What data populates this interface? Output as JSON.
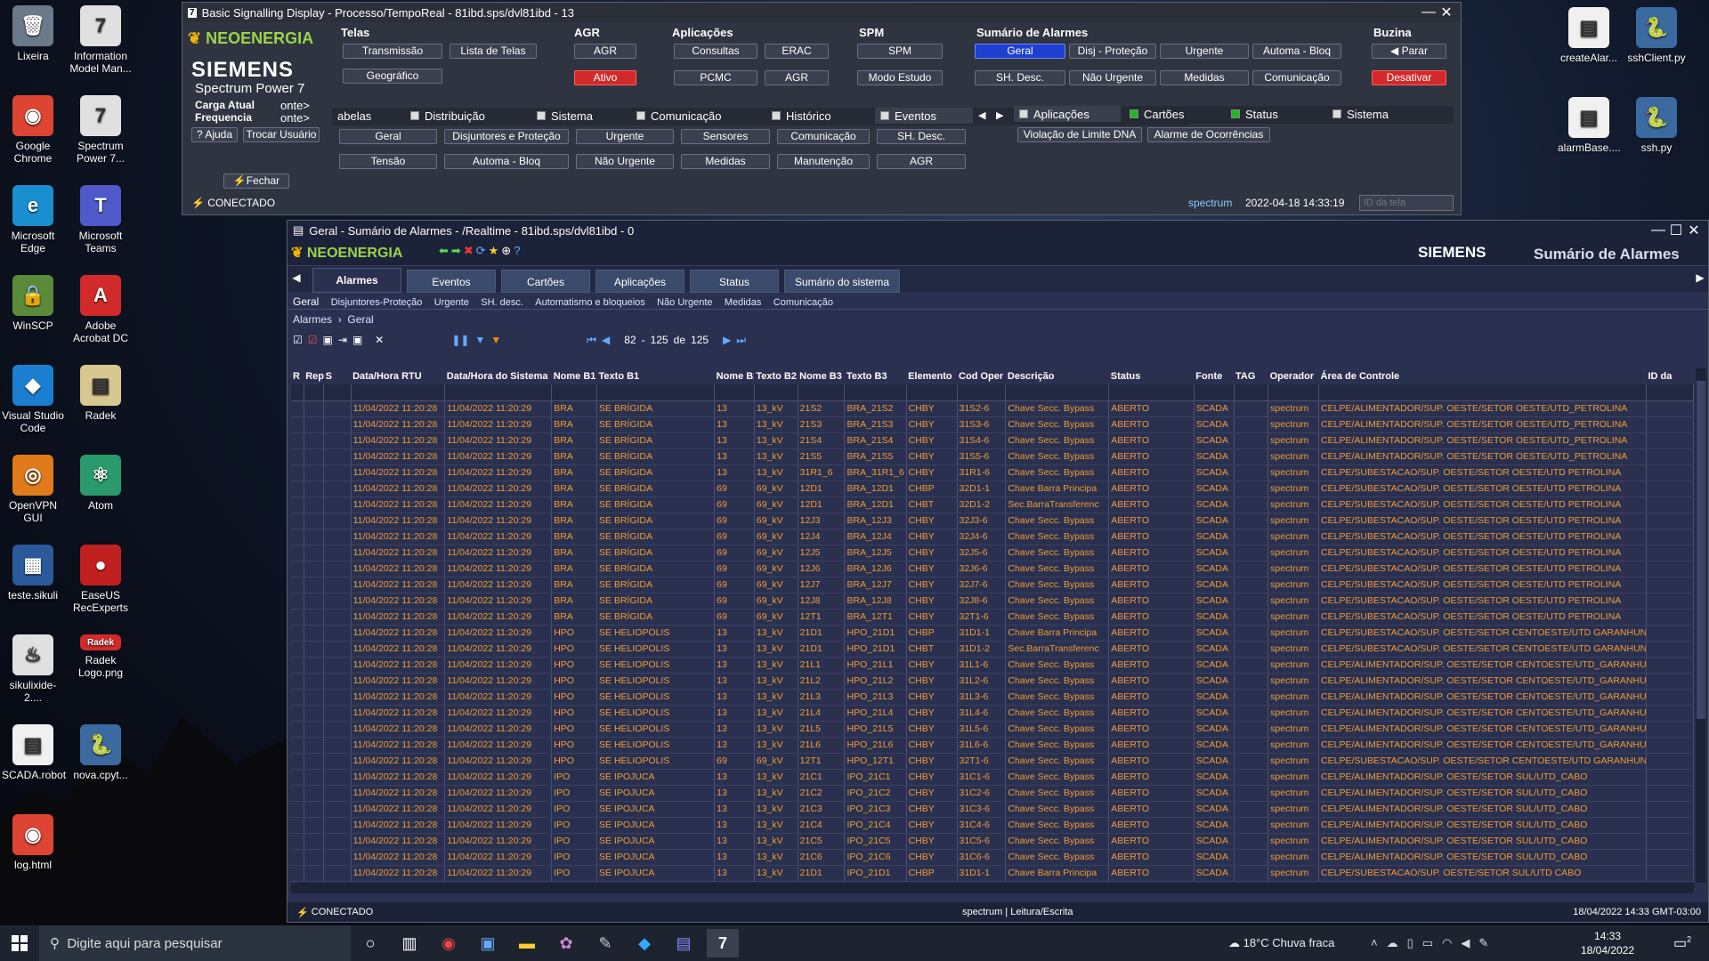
{
  "desktop": {
    "icons": [
      {
        "label": "Lixeira",
        "glyph": "🗑",
        "bg": "#6b7a8a"
      },
      {
        "label": "Information Model Man...",
        "glyph": "7",
        "bg": "#e0e0e0"
      },
      {
        "label": "Google Chrome",
        "glyph": "◉",
        "bg": "#dd4433"
      },
      {
        "label": "Spectrum Power 7...",
        "glyph": "7",
        "bg": "#e0e0e0"
      },
      {
        "label": "Microsoft Edge",
        "glyph": "e",
        "bg": "#1a8fd0"
      },
      {
        "label": "Microsoft Teams",
        "glyph": "T",
        "bg": "#5059c9"
      },
      {
        "label": "WinSCP",
        "glyph": "🔒",
        "bg": "#5a8a3a"
      },
      {
        "label": "Adobe Acrobat DC",
        "glyph": "A",
        "bg": "#d22a2a"
      },
      {
        "label": "Visual Studio Code",
        "glyph": "◆",
        "bg": "#1a7fd0"
      },
      {
        "label": "Radek",
        "glyph": "▤",
        "bg": "#d8c890"
      },
      {
        "label": "OpenVPN GUI",
        "glyph": "◎",
        "bg": "#e07a1a"
      },
      {
        "label": "Atom",
        "glyph": "⚛",
        "bg": "#2a9a6a"
      },
      {
        "label": "teste.sikuli",
        "glyph": "▦",
        "bg": "#2a5a9a"
      },
      {
        "label": "EaseUS RecExperts",
        "glyph": "●",
        "bg": "#c02020"
      },
      {
        "label": "sikulixide-2....",
        "glyph": "♨",
        "bg": "#e0e0e0"
      },
      {
        "label": "Radek Logo.png",
        "glyph": "Radek",
        "bg": "#d22a2a"
      },
      {
        "label": "SCADA.robot",
        "glyph": "▤",
        "bg": "#f0f0f0"
      },
      {
        "label": "nova.cpyt...",
        "glyph": "🐍",
        "bg": "#3a6aa0"
      },
      {
        "label": "log.html",
        "glyph": "◉",
        "bg": "#dd4433"
      }
    ],
    "right_icons": [
      {
        "label": "createAlar...",
        "glyph": "▤",
        "bg": "#f0f0f0"
      },
      {
        "label": "sshClient.py",
        "glyph": "🐍",
        "bg": "#3a6aa0"
      },
      {
        "label": "alarmBase....",
        "glyph": "▤",
        "bg": "#f0f0f0"
      },
      {
        "label": "ssh.py",
        "glyph": "🐍",
        "bg": "#3a6aa0"
      }
    ]
  },
  "w1": {
    "title": "Basic Signalling Display - Processo/TempoReal - 81ibd.sps/dvl81ibd - 13",
    "logo": "NEOENERGIA",
    "siemens": "SIEMENS",
    "product": "Spectrum Power 7",
    "carga": "Carga Atual",
    "freq": "Frequencia",
    "conte1": "onte>",
    "conte2": "onte>",
    "ajuda": "Ajuda",
    "trocar": "Trocar Usuário",
    "fechar": "Fechar",
    "conectado": "CONECTADO",
    "sections": {
      "telas": "Telas",
      "agr": "AGR",
      "aplicacoes": "Aplicações",
      "spm": "SPM",
      "sumario": "Sumário de Alarmes",
      "buzina": "Buzina"
    },
    "btn": {
      "transmissao": "Transmissão",
      "lista": "Lista de Telas",
      "geografico": "Geográfico",
      "agr": "AGR",
      "ativo": "Ativo",
      "consultas": "Consultas",
      "erac": "ERAC",
      "pcmc": "PCMC",
      "agr2": "AGR",
      "spm": "SPM",
      "modo": "Modo Estudo",
      "geral": "Geral",
      "disj": "Disj - Proteção",
      "urgente": "Urgente",
      "automa": "Automa - Bloq",
      "shdesc": "SH. Desc.",
      "naourg": "Não Urgente",
      "medidas": "Medidas",
      "comunic": "Comunicação",
      "parar": "Parar",
      "desativar": "Desativar"
    },
    "tabs": [
      "abelas",
      "Distribuição",
      "Sistema",
      "Comunicação",
      "Histórico",
      "Eventos"
    ],
    "tabs2": [
      "Aplicações",
      "Cartões",
      "Status",
      "Sistema"
    ],
    "row1": [
      "Geral",
      "Disjuntores e Proteção",
      "Urgente",
      "Sensores",
      "Comunicação",
      "SH. Desc."
    ],
    "row2": [
      "Tensão",
      "Automa - Bloq",
      "Não Urgente",
      "Medidas",
      "Manutenção",
      "AGR"
    ],
    "app1": "Violação de Limite DNA",
    "app2": "Alarme de Ocorrências",
    "user": "spectrum",
    "datetime": "2022-04-18 14:33:19",
    "idplaceholder": "ID da tela"
  },
  "w2": {
    "title": "Geral - Sumário de Alarmes - /Realtime - 81ibd.sps/dvl81ibd - 0",
    "logo": "NEOENERGIA",
    "siemens": "SIEMENS",
    "heading": "Sumário de Alarmes",
    "tabs": [
      "Alarmes",
      "Eventos",
      "Cartões",
      "Aplicações",
      "Status",
      "Sumário do sistema"
    ],
    "subnav": [
      "Geral",
      "Disjuntores-Proteção",
      "Urgente",
      "SH. desc.",
      "Automatismo e bloqueios",
      "Não Urgente",
      "Medidas",
      "Comunicação"
    ],
    "crumb1": "Alarmes",
    "crumb2": "Geral",
    "pager": {
      "from": "82",
      "to": "125",
      "de": "de",
      "total": "125"
    },
    "columns": [
      "R",
      "Rep",
      "S",
      "Data/Hora RTU",
      "Data/Hora do Sistema",
      "Nome B1",
      "Texto B1",
      "Nome B2",
      "Texto B2",
      "Nome B3",
      "Texto B3",
      "Elemento",
      "Cod Oper",
      "Descrição",
      "Status",
      "Fonte",
      "TAG",
      "Operador",
      "Área de Controle",
      "ID da"
    ],
    "rows": [
      [
        "BRA",
        "SE BRÍGIDA",
        "13",
        "13_kV",
        "21S2",
        "BRA_21S2",
        "CHBY",
        "31S2-6",
        "Chave Secc. Bypass",
        "CELPE/ALIMENTADOR/SUP. OESTE/SETOR OESTE/UTD_PETROLINA"
      ],
      [
        "BRA",
        "SE BRÍGIDA",
        "13",
        "13_kV",
        "21S3",
        "BRA_21S3",
        "CHBY",
        "31S3-6",
        "Chave Secc. Bypass",
        "CELPE/ALIMENTADOR/SUP. OESTE/SETOR OESTE/UTD_PETROLINA"
      ],
      [
        "BRA",
        "SE BRÍGIDA",
        "13",
        "13_kV",
        "21S4",
        "BRA_21S4",
        "CHBY",
        "31S4-6",
        "Chave Secc. Bypass",
        "CELPE/ALIMENTADOR/SUP. OESTE/SETOR OESTE/UTD_PETROLINA"
      ],
      [
        "BRA",
        "SE BRÍGIDA",
        "13",
        "13_kV",
        "21S5",
        "BRA_21S5",
        "CHBY",
        "31S5-6",
        "Chave Secc. Bypass",
        "CELPE/ALIMENTADOR/SUP. OESTE/SETOR OESTE/UTD_PETROLINA"
      ],
      [
        "BRA",
        "SE BRÍGIDA",
        "13",
        "13_kV",
        "31R1_6",
        "BRA_31R1_6",
        "CHBY",
        "31R1-6",
        "Chave Secc. Bypass",
        "CELPE/SUBESTACAO/SUP. OESTE/SETOR OESTE/UTD PETROLINA"
      ],
      [
        "BRA",
        "SE BRÍGIDA",
        "69",
        "69_kV",
        "12D1",
        "BRA_12D1",
        "CHBP",
        "32D1-1",
        "Chave Barra Principa",
        "CELPE/SUBESTACAO/SUP. OESTE/SETOR OESTE/UTD PETROLINA"
      ],
      [
        "BRA",
        "SE BRÍGIDA",
        "69",
        "69_kV",
        "12D1",
        "BRA_12D1",
        "CHBT",
        "32D1-2",
        "Sec.BarraTransferenc",
        "CELPE/SUBESTACAO/SUP. OESTE/SETOR OESTE/UTD PETROLINA"
      ],
      [
        "BRA",
        "SE BRÍGIDA",
        "69",
        "69_kV",
        "12J3",
        "BRA_12J3",
        "CHBY",
        "32J3-6",
        "Chave Secc. Bypass",
        "CELPE/SUBESTACAO/SUP. OESTE/SETOR OESTE/UTD PETROLINA"
      ],
      [
        "BRA",
        "SE BRÍGIDA",
        "69",
        "69_kV",
        "12J4",
        "BRA_12J4",
        "CHBY",
        "32J4-6",
        "Chave Secc. Bypass",
        "CELPE/SUBESTACAO/SUP. OESTE/SETOR OESTE/UTD PETROLINA"
      ],
      [
        "BRA",
        "SE BRÍGIDA",
        "69",
        "69_kV",
        "12J5",
        "BRA_12J5",
        "CHBY",
        "32J5-6",
        "Chave Secc. Bypass",
        "CELPE/SUBESTACAO/SUP. OESTE/SETOR OESTE/UTD PETROLINA"
      ],
      [
        "BRA",
        "SE BRÍGIDA",
        "69",
        "69_kV",
        "12J6",
        "BRA_12J6",
        "CHBY",
        "32J6-6",
        "Chave Secc. Bypass",
        "CELPE/SUBESTACAO/SUP. OESTE/SETOR OESTE/UTD PETROLINA"
      ],
      [
        "BRA",
        "SE BRÍGIDA",
        "69",
        "69_kV",
        "12J7",
        "BRA_12J7",
        "CHBY",
        "32J7-6",
        "Chave Secc. Bypass",
        "CELPE/SUBESTACAO/SUP. OESTE/SETOR OESTE/UTD PETROLINA"
      ],
      [
        "BRA",
        "SE BRÍGIDA",
        "69",
        "69_kV",
        "12J8",
        "BRA_12J8",
        "CHBY",
        "32J8-6",
        "Chave Secc. Bypass",
        "CELPE/SUBESTACAO/SUP. OESTE/SETOR OESTE/UTD PETROLINA"
      ],
      [
        "BRA",
        "SE BRÍGIDA",
        "69",
        "69_kV",
        "12T1",
        "BRA_12T1",
        "CHBY",
        "32T1-6",
        "Chave Secc. Bypass",
        "CELPE/SUBESTACAO/SUP. OESTE/SETOR OESTE/UTD PETROLINA"
      ],
      [
        "HPO",
        "SE HELIOPOLIS",
        "13",
        "13_kV",
        "21D1",
        "HPO_21D1",
        "CHBP",
        "31D1-1",
        "Chave Barra Principa",
        "CELPE/SUBESTACAO/SUP. OESTE/SETOR CENTOESTE/UTD GARANHUNS"
      ],
      [
        "HPO",
        "SE HELIOPOLIS",
        "13",
        "13_kV",
        "21D1",
        "HPO_21D1",
        "CHBT",
        "31D1-2",
        "Sec.BarraTransferenc",
        "CELPE/SUBESTACAO/SUP. OESTE/SETOR CENTOESTE/UTD GARANHUNS"
      ],
      [
        "HPO",
        "SE HELIOPOLIS",
        "13",
        "13_kV",
        "21L1",
        "HPO_21L1",
        "CHBY",
        "31L1-6",
        "Chave Secc. Bypass",
        "CELPE/ALIMENTADOR/SUP. OESTE/SETOR CENTOESTE/UTD_GARANHUNS"
      ],
      [
        "HPO",
        "SE HELIOPOLIS",
        "13",
        "13_kV",
        "21L2",
        "HPO_21L2",
        "CHBY",
        "31L2-6",
        "Chave Secc. Bypass",
        "CELPE/ALIMENTADOR/SUP. OESTE/SETOR CENTOESTE/UTD_GARANHUNS"
      ],
      [
        "HPO",
        "SE HELIOPOLIS",
        "13",
        "13_kV",
        "21L3",
        "HPO_21L3",
        "CHBY",
        "31L3-6",
        "Chave Secc. Bypass",
        "CELPE/ALIMENTADOR/SUP. OESTE/SETOR CENTOESTE/UTD_GARANHUNS"
      ],
      [
        "HPO",
        "SE HELIOPOLIS",
        "13",
        "13_kV",
        "21L4",
        "HPO_21L4",
        "CHBY",
        "31L4-6",
        "Chave Secc. Bypass",
        "CELPE/ALIMENTADOR/SUP. OESTE/SETOR CENTOESTE/UTD_GARANHUNS"
      ],
      [
        "HPO",
        "SE HELIOPOLIS",
        "13",
        "13_kV",
        "21L5",
        "HPO_21L5",
        "CHBY",
        "31L5-6",
        "Chave Secc. Bypass",
        "CELPE/ALIMENTADOR/SUP. OESTE/SETOR CENTOESTE/UTD_GARANHUNS"
      ],
      [
        "HPO",
        "SE HELIOPOLIS",
        "13",
        "13_kV",
        "21L6",
        "HPO_21L6",
        "CHBY",
        "31L6-6",
        "Chave Secc. Bypass",
        "CELPE/ALIMENTADOR/SUP. OESTE/SETOR CENTOESTE/UTD_GARANHUNS"
      ],
      [
        "HPO",
        "SE HELIOPOLIS",
        "69",
        "69_kV",
        "12T1",
        "HPO_12T1",
        "CHBY",
        "32T1-6",
        "Chave Secc. Bypass",
        "CELPE/SUBESTACAO/SUP. OESTE/SETOR CENTOESTE/UTD GARANHUNS"
      ],
      [
        "IPO",
        "SE IPOJUCA",
        "13",
        "13_kV",
        "21C1",
        "IPO_21C1",
        "CHBY",
        "31C1-6",
        "Chave Secc. Bypass",
        "CELPE/ALIMENTADOR/SUP. OESTE/SETOR SUL/UTD_CABO"
      ],
      [
        "IPO",
        "SE IPOJUCA",
        "13",
        "13_kV",
        "21C2",
        "IPO_21C2",
        "CHBY",
        "31C2-6",
        "Chave Secc. Bypass",
        "CELPE/ALIMENTADOR/SUP. OESTE/SETOR SUL/UTD_CABO"
      ],
      [
        "IPO",
        "SE IPOJUCA",
        "13",
        "13_kV",
        "21C3",
        "IPO_21C3",
        "CHBY",
        "31C3-6",
        "Chave Secc. Bypass",
        "CELPE/ALIMENTADOR/SUP. OESTE/SETOR SUL/UTD_CABO"
      ],
      [
        "IPO",
        "SE IPOJUCA",
        "13",
        "13_kV",
        "21C4",
        "IPO_21C4",
        "CHBY",
        "31C4-6",
        "Chave Secc. Bypass",
        "CELPE/ALIMENTADOR/SUP. OESTE/SETOR SUL/UTD_CABO"
      ],
      [
        "IPO",
        "SE IPOJUCA",
        "13",
        "13_kV",
        "21C5",
        "IPO_21C5",
        "CHBY",
        "31C5-6",
        "Chave Secc. Bypass",
        "CELPE/ALIMENTADOR/SUP. OESTE/SETOR SUL/UTD_CABO"
      ],
      [
        "IPO",
        "SE IPOJUCA",
        "13",
        "13_kV",
        "21C6",
        "IPO_21C6",
        "CHBY",
        "31C6-6",
        "Chave Secc. Bypass",
        "CELPE/ALIMENTADOR/SUP. OESTE/SETOR SUL/UTD_CABO"
      ],
      [
        "IPO",
        "SE IPOJUCA",
        "13",
        "13_kV",
        "21D1",
        "IPO_21D1",
        "CHBP",
        "31D1-1",
        "Chave Barra Principa",
        "CELPE/SUBESTACAO/SUP. OESTE/SETOR SUL/UTD CABO"
      ]
    ],
    "rtu": "11/04/2022 11:20:28",
    "sys": "11/04/2022 11:20:29",
    "status": "ABERTO",
    "fonte": "SCADA",
    "operador": "spectrum",
    "footer_con": "CONECTADO",
    "footer_user": "spectrum | Leitura/Escrita",
    "footer_time": "18/04/2022 14:33 GMT-03:00"
  },
  "taskbar": {
    "search": "Digite aqui para pesquisar",
    "weather": "18°C  Chuva fraca",
    "time": "14:33",
    "date": "18/04/2022",
    "notif": "2"
  },
  "colors": {
    "alarm_text": "#f29a35",
    "table_bg": "#2a3150",
    "panel": "#2e3440"
  }
}
